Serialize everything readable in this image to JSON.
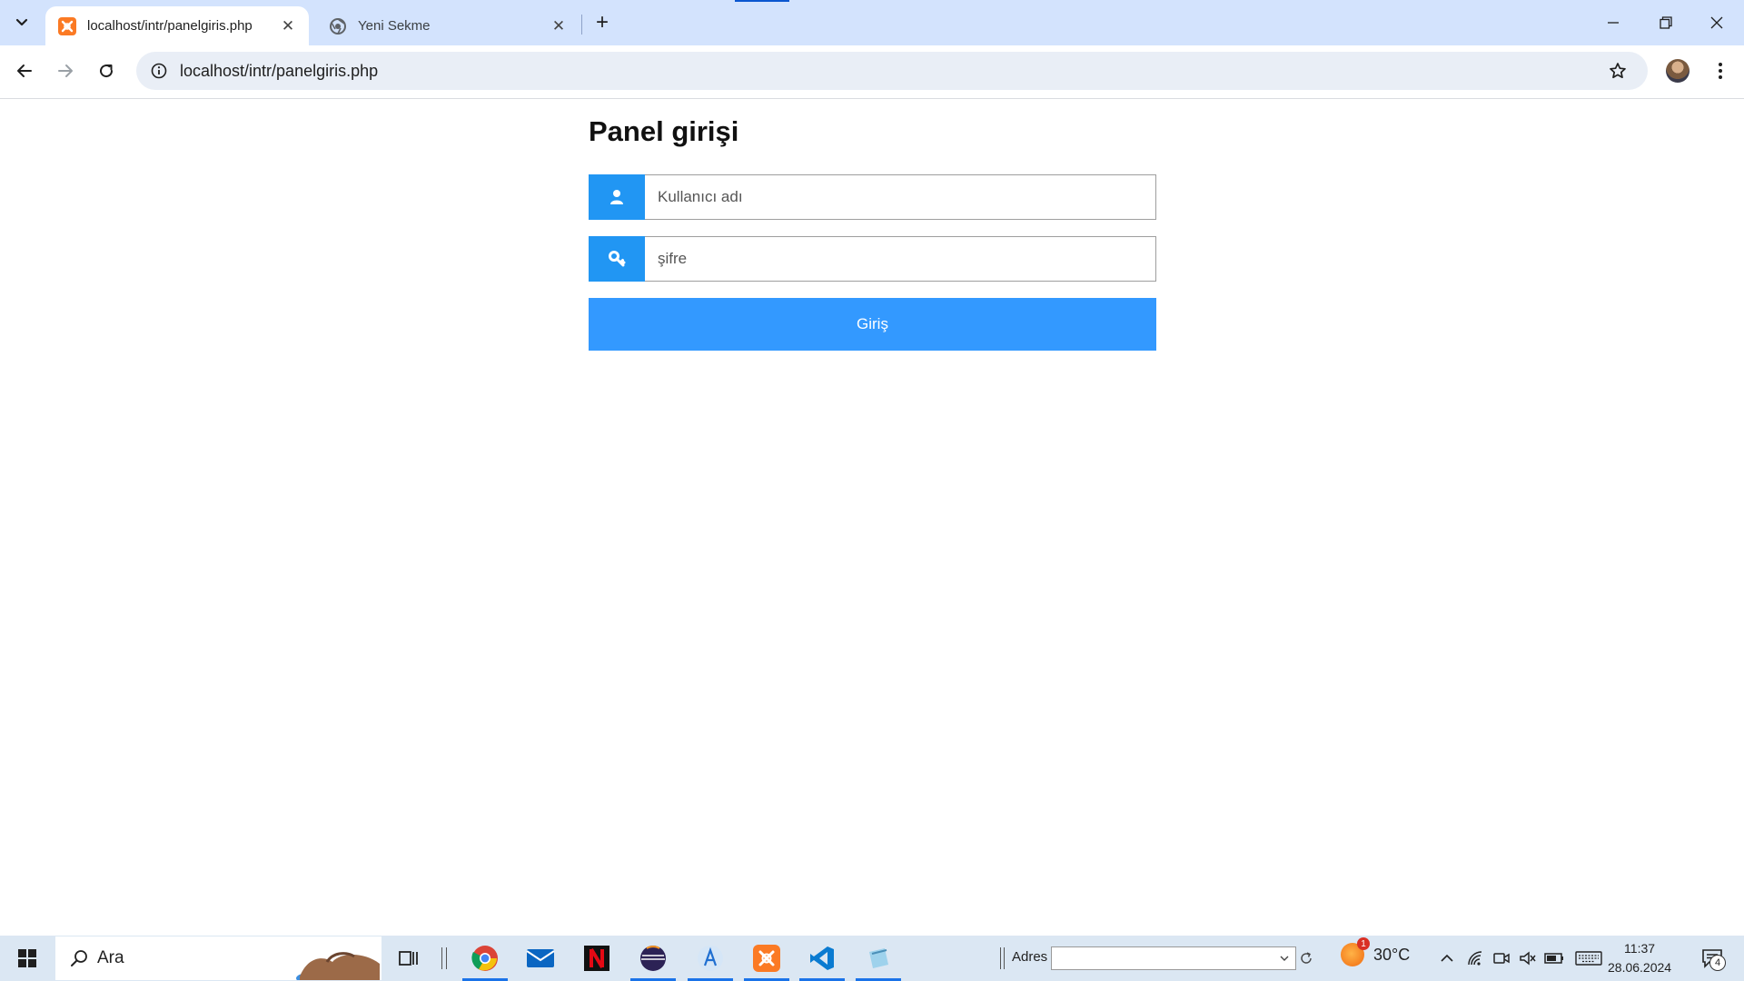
{
  "browser": {
    "tabs": [
      {
        "title": "localhost/intr/panelgiris.php",
        "active": true
      },
      {
        "title": "Yeni Sekme",
        "active": false
      }
    ],
    "close_glyph": "✕",
    "newtab_glyph": "+",
    "url": "localhost/intr/panelgiris.php",
    "accent": "#0b57d0"
  },
  "page": {
    "title": "Panel girişi",
    "username": {
      "placeholder": "Kullanıcı adı",
      "icon": "user-icon"
    },
    "password": {
      "placeholder": "şifre",
      "icon": "key-icon"
    },
    "login_label": "Giriş",
    "brand_color": "#2196f3",
    "button_color": "#3399ff"
  },
  "taskbar": {
    "search_label": "Ara",
    "address_label": "Adres",
    "weather": {
      "temp": "30°C",
      "badge": "1"
    },
    "clock": {
      "time": "11:37",
      "date": "28.06.2024"
    },
    "notifications": "4",
    "pinned": [
      "chrome-icon",
      "mail-icon",
      "netflix-icon",
      "eclipse-icon",
      "typora-icon",
      "xampp-icon",
      "vscode-icon",
      "notes-icon"
    ]
  }
}
